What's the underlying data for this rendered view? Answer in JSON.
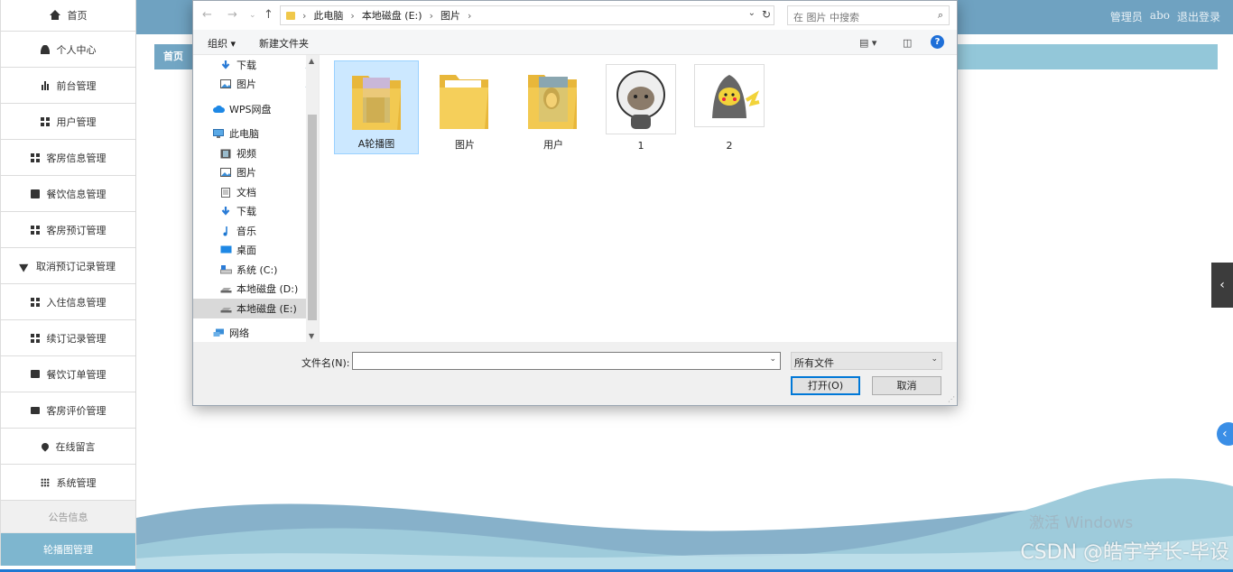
{
  "app": {
    "header": {
      "role": "管理员",
      "user": "abo",
      "logout": "退出登录"
    },
    "breadcrumb": {
      "home": "首页"
    },
    "sidebar": [
      {
        "label": "首页",
        "icon": "home-icon"
      },
      {
        "label": "个人中心",
        "icon": "user-icon"
      },
      {
        "label": "前台管理",
        "icon": "bar-chart-icon"
      },
      {
        "label": "用户管理",
        "icon": "grid-icon"
      },
      {
        "label": "客房信息管理",
        "icon": "grid-icon"
      },
      {
        "label": "餐饮信息管理",
        "icon": "book-icon"
      },
      {
        "label": "客房预订管理",
        "icon": "grid-icon"
      },
      {
        "label": "取消预订记录管理",
        "icon": "send-icon"
      },
      {
        "label": "入住信息管理",
        "icon": "grid-icon"
      },
      {
        "label": "续订记录管理",
        "icon": "grid-icon"
      },
      {
        "label": "餐饮订单管理",
        "icon": "print-icon"
      },
      {
        "label": "客房评价管理",
        "icon": "briefcase-icon"
      },
      {
        "label": "在线留言",
        "icon": "pin-icon"
      },
      {
        "label": "系统管理",
        "icon": "dots-grid-icon"
      }
    ],
    "sidebar_sub": [
      {
        "label": "公告信息",
        "active": false
      },
      {
        "label": "轮播图管理",
        "active": true
      }
    ],
    "watermark": "CSDN @皓宇学长-毕设",
    "activation": "激活 Windows"
  },
  "dialog": {
    "path": [
      "此电脑",
      "本地磁盘 (E:)",
      "图片"
    ],
    "search_placeholder": "在 图片 中搜索",
    "toolbar": {
      "organize": "组织 ▾",
      "new_folder": "新建文件夹"
    },
    "nav": [
      {
        "label": "下载",
        "icon": "download-icon",
        "pinned": true,
        "indent": 2
      },
      {
        "label": "图片",
        "icon": "pictures-icon",
        "pinned": true,
        "indent": 2
      },
      {
        "label": "WPS网盘",
        "icon": "cloud-icon",
        "pinned": false,
        "indent": 1,
        "gap": true
      },
      {
        "label": "此电脑",
        "icon": "computer-icon",
        "pinned": false,
        "indent": 1,
        "gap": true
      },
      {
        "label": "视频",
        "icon": "video-icon",
        "pinned": false,
        "indent": 2
      },
      {
        "label": "图片",
        "icon": "pictures-icon",
        "pinned": false,
        "indent": 2
      },
      {
        "label": "文档",
        "icon": "document-icon",
        "pinned": false,
        "indent": 2
      },
      {
        "label": "下载",
        "icon": "download-icon",
        "pinned": false,
        "indent": 2
      },
      {
        "label": "音乐",
        "icon": "music-icon",
        "pinned": false,
        "indent": 2
      },
      {
        "label": "桌面",
        "icon": "desktop-icon",
        "pinned": false,
        "indent": 2
      },
      {
        "label": "系统 (C:)",
        "icon": "drive-c-icon",
        "pinned": false,
        "indent": 2
      },
      {
        "label": "本地磁盘 (D:)",
        "icon": "drive-icon",
        "pinned": false,
        "indent": 2
      },
      {
        "label": "本地磁盘 (E:)",
        "icon": "drive-icon",
        "pinned": false,
        "indent": 2,
        "selected": true
      },
      {
        "label": "网络",
        "icon": "network-icon",
        "pinned": false,
        "indent": 1,
        "gap": true
      }
    ],
    "files": [
      {
        "label": "A轮播图",
        "type": "folder-photo",
        "selected": true
      },
      {
        "label": "图片",
        "type": "folder",
        "selected": false
      },
      {
        "label": "用户",
        "type": "folder-photo2",
        "selected": false
      },
      {
        "label": "1",
        "type": "image-astronaut",
        "selected": false
      },
      {
        "label": "2",
        "type": "image-pikachu",
        "selected": false
      }
    ],
    "filename_label": "文件名(N):",
    "filename_value": "",
    "filter_value": "所有文件",
    "open_button": "打开(O)",
    "cancel_button": "取消"
  },
  "colors": {
    "header": "#6fa2c1",
    "crumb": "#93c7d9",
    "accent": "#0078d7",
    "active_sidebar": "#7eb6cf"
  }
}
